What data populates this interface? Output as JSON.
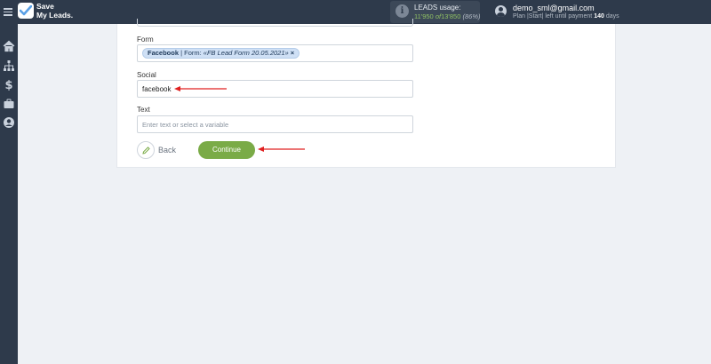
{
  "brand": {
    "line1": "Save",
    "line2": "My Leads."
  },
  "usage": {
    "title": "LEADS usage:",
    "used": "11'950",
    "of": "of",
    "total": "13'850",
    "percent": "(86%)"
  },
  "user": {
    "email": "demo_sml@gmail.com",
    "plan_prefix": "Plan |Start| left until payment",
    "days": "140",
    "days_suffix": "days"
  },
  "sidebar": {
    "items": [
      "home-icon",
      "sitemap-icon",
      "dollar-icon",
      "briefcase-icon",
      "user-circle-icon"
    ]
  },
  "form": {
    "form_label": "Form",
    "form_tag_bold": "Facebook",
    "form_tag_rest": " | Form: ",
    "form_tag_italic": "«FB Lead Form 20.05.2021»",
    "form_tag_remove": "×",
    "social_label": "Social",
    "social_value": "facebook",
    "text_label": "Text",
    "text_placeholder": "Enter text or select a variable"
  },
  "actions": {
    "back_label": "Back",
    "continue_label": "Continue"
  },
  "colors": {
    "topbar": "#2e3a4b",
    "accent_green": "#7aab47",
    "arrow_red": "#e02020"
  }
}
